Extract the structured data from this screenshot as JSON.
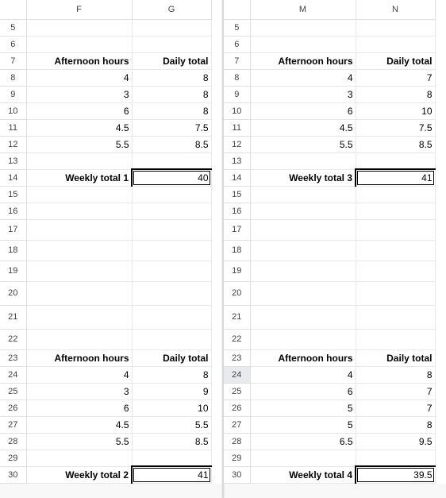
{
  "columns_left": [
    "F",
    "G"
  ],
  "columns_right": [
    "M",
    "N"
  ],
  "row_labels": [
    "5",
    "6",
    "7",
    "8",
    "9",
    "10",
    "11",
    "12",
    "13",
    "14",
    "15",
    "16",
    "17",
    "18",
    "19",
    "20",
    "21",
    "22",
    "23",
    "24",
    "25",
    "26",
    "27",
    "28",
    "29",
    "30"
  ],
  "headers": {
    "afternoon": "Afternoon hours",
    "daily": "Daily total"
  },
  "sections": {
    "top_left": {
      "label": "Weekly total 1",
      "total": "40",
      "rows": [
        {
          "a": "4",
          "d": "8"
        },
        {
          "a": "3",
          "d": "8"
        },
        {
          "a": "6",
          "d": "8"
        },
        {
          "a": "4.5",
          "d": "7.5"
        },
        {
          "a": "5.5",
          "d": "8.5"
        }
      ]
    },
    "top_right": {
      "label": "Weekly total 3",
      "total": "41",
      "rows": [
        {
          "a": "4",
          "d": "7"
        },
        {
          "a": "3",
          "d": "8"
        },
        {
          "a": "6",
          "d": "10"
        },
        {
          "a": "4.5",
          "d": "7.5"
        },
        {
          "a": "5.5",
          "d": "8.5"
        }
      ]
    },
    "bot_left": {
      "label": "Weekly total 2",
      "total": "41",
      "rows": [
        {
          "a": "4",
          "d": "8"
        },
        {
          "a": "3",
          "d": "9"
        },
        {
          "a": "6",
          "d": "10"
        },
        {
          "a": "4.5",
          "d": "5.5"
        },
        {
          "a": "5.5",
          "d": "8.5"
        }
      ]
    },
    "bot_right": {
      "label": "Weekly total 4",
      "total": "39.5",
      "rows": [
        {
          "a": "4",
          "d": "8"
        },
        {
          "a": "6",
          "d": "7"
        },
        {
          "a": "5",
          "d": "7"
        },
        {
          "a": "5",
          "d": "8"
        },
        {
          "a": "6.5",
          "d": "9.5"
        }
      ]
    }
  },
  "chart_data": [
    {
      "type": "table",
      "title": "Weekly total 1",
      "columns": [
        "Afternoon hours",
        "Daily total"
      ],
      "values": [
        [
          4,
          8
        ],
        [
          3,
          8
        ],
        [
          6,
          8
        ],
        [
          4.5,
          7.5
        ],
        [
          5.5,
          8.5
        ]
      ],
      "total": 40
    },
    {
      "type": "table",
      "title": "Weekly total 2",
      "columns": [
        "Afternoon hours",
        "Daily total"
      ],
      "values": [
        [
          4,
          8
        ],
        [
          3,
          9
        ],
        [
          6,
          10
        ],
        [
          4.5,
          5.5
        ],
        [
          5.5,
          8.5
        ]
      ],
      "total": 41
    },
    {
      "type": "table",
      "title": "Weekly total 3",
      "columns": [
        "Afternoon hours",
        "Daily total"
      ],
      "values": [
        [
          4,
          7
        ],
        [
          3,
          8
        ],
        [
          6,
          10
        ],
        [
          4.5,
          7.5
        ],
        [
          5.5,
          8.5
        ]
      ],
      "total": 41
    },
    {
      "type": "table",
      "title": "Weekly total 4",
      "columns": [
        "Afternoon hours",
        "Daily total"
      ],
      "values": [
        [
          4,
          8
        ],
        [
          6,
          7
        ],
        [
          5,
          7
        ],
        [
          5,
          8
        ],
        [
          6.5,
          9.5
        ]
      ],
      "total": 39.5
    }
  ],
  "selected_row_right": "24"
}
